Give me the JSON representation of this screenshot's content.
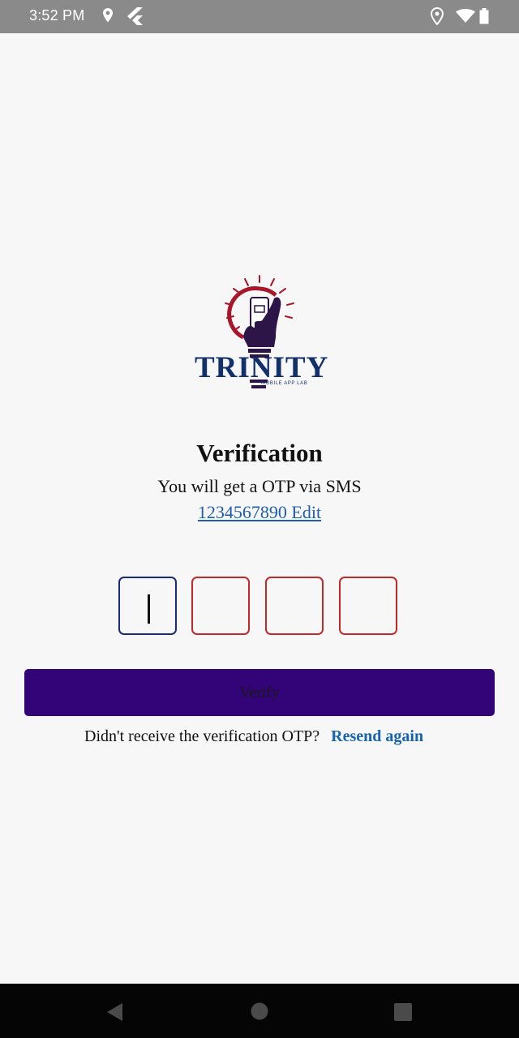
{
  "status_bar": {
    "time": "3:52 PM",
    "left_icons": [
      "location-pin-icon",
      "flutter-icon"
    ],
    "right_icons": [
      "location-pin-icon",
      "wifi-icon",
      "battery-icon"
    ]
  },
  "logo": {
    "name": "TRINITY",
    "tagline": "MOBILE APP LAB"
  },
  "verification": {
    "title": "Verification",
    "subtitle": "You will get a OTP via SMS",
    "phone_edit": "1234567890 Edit"
  },
  "otp": {
    "digits": [
      "",
      "",
      "",
      ""
    ],
    "active_index": 0
  },
  "verify_button": {
    "label": "Verify"
  },
  "resend": {
    "prompt": "Didn't receive the verification OTP?",
    "link": "Resend again"
  },
  "nav_bar": {
    "buttons": [
      "back-icon",
      "home-icon",
      "recents-icon"
    ]
  },
  "colors": {
    "primary": "#330478",
    "link": "#1663b0",
    "otp_border": "#c22a2a",
    "otp_active_border": "#1a2a7a",
    "logo_navy": "#12306a",
    "logo_red": "#a8162a"
  }
}
